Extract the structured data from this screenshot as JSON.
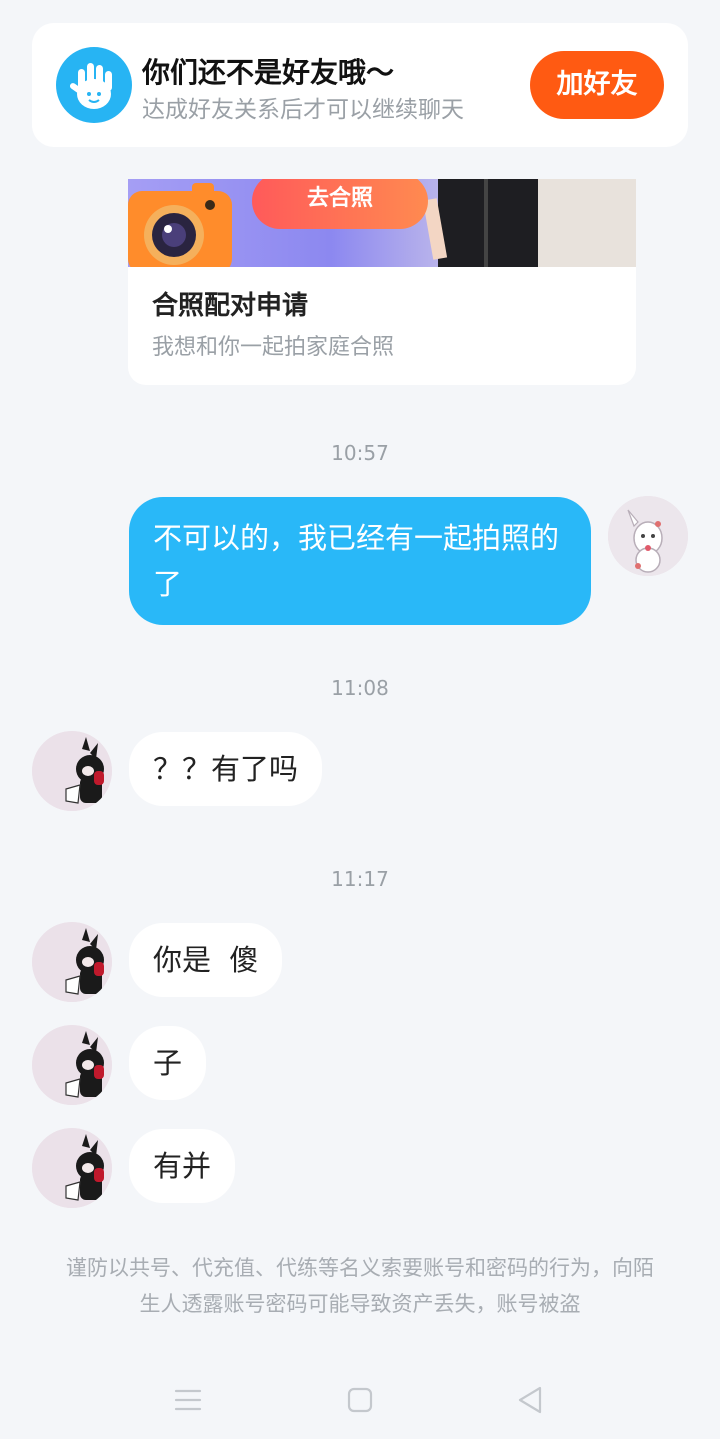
{
  "banner": {
    "title": "你们还不是好友哦～",
    "subtitle": "达成好友关系后才可以继续聊天",
    "add_friend_label": "加好友"
  },
  "photo_card": {
    "button_label": "去合照",
    "title": "合照配对申请",
    "description": "我想和你一起拍家庭合照"
  },
  "messages": [
    {
      "type": "time",
      "text": "10:57"
    },
    {
      "type": "outgoing",
      "text": "不可以的，我已经有一起拍照的了"
    },
    {
      "type": "time",
      "text": "11:08"
    },
    {
      "type": "incoming",
      "text": "？？有了吗"
    },
    {
      "type": "time",
      "text": "11:17"
    },
    {
      "type": "incoming",
      "text": "你是  傻"
    },
    {
      "type": "incoming",
      "text": "子"
    },
    {
      "type": "incoming",
      "text": "有并"
    }
  ],
  "notice": "谨防以共号、代充值、代练等名义索要账号和密码的行为，向陌生人透露账号密码可能导致资产丢失，账号被盗",
  "icons": {
    "banner_avatar": "waving-hand-icon",
    "card_camera": "camera-icon",
    "nav": [
      "menu-icon",
      "home-icon",
      "back-icon"
    ]
  },
  "colors": {
    "accent_blue": "#29b8f8",
    "add_friend_orange": "#ff5a12",
    "background": "#f4f6f9"
  }
}
